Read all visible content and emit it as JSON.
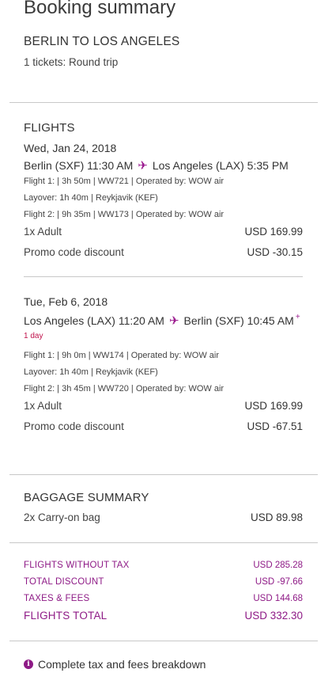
{
  "summary": {
    "title": "Booking summary",
    "route": "BERLIN TO LOS ANGELES",
    "tickets": "1 tickets: Round trip"
  },
  "flights": {
    "heading": "FLIGHTS",
    "outbound": {
      "date": "Wed, Jan 24, 2018",
      "from": "Berlin (SXF) 11:30 AM",
      "to": "Los Angeles (LAX) 5:35 PM",
      "flight1": "Flight 1: | 3h 50m | WW721 | Operated by: WOW air",
      "layover": "Layover: 1h 40m | Reykjavik (KEF)",
      "flight2": "Flight 2: | 9h 35m | WW173 | Operated by: WOW air",
      "adult_label": "1x Adult",
      "adult_price": "USD 169.99",
      "promo_label": "Promo code discount",
      "promo_price": "USD -30.15"
    },
    "inbound": {
      "date": "Tue, Feb 6, 2018",
      "from": "Los Angeles (LAX) 11:20 AM",
      "to": "Berlin (SXF) 10:45 AM",
      "plus": "+",
      "next_day": "1 day",
      "flight1": "Flight 1: | 9h 0m | WW174 | Operated by: WOW air",
      "layover": "Layover: 1h 40m | Reykjavik (KEF)",
      "flight2": "Flight 2: | 3h 45m | WW720 | Operated by: WOW air",
      "adult_label": "1x Adult",
      "adult_price": "USD 169.99",
      "promo_label": "Promo code discount",
      "promo_price": "USD -67.51"
    }
  },
  "baggage": {
    "heading": "BAGGAGE SUMMARY",
    "item_label": "2x Carry-on bag",
    "item_price": "USD 89.98"
  },
  "totals": {
    "without_tax_label": "FLIGHTS WITHOUT TAX",
    "without_tax_value": "USD 285.28",
    "discount_label": "TOTAL DISCOUNT",
    "discount_value": "USD -97.66",
    "taxes_label": "TAXES & FEES",
    "taxes_value": "USD 144.68",
    "total_label": "FLIGHTS TOTAL",
    "total_value": "USD 332.30"
  },
  "breakdown": {
    "icon": "info-icon",
    "label": "Complete tax and fees breakdown"
  },
  "colors": {
    "accent": "#8e1a86",
    "next_day": "#c0124b"
  }
}
